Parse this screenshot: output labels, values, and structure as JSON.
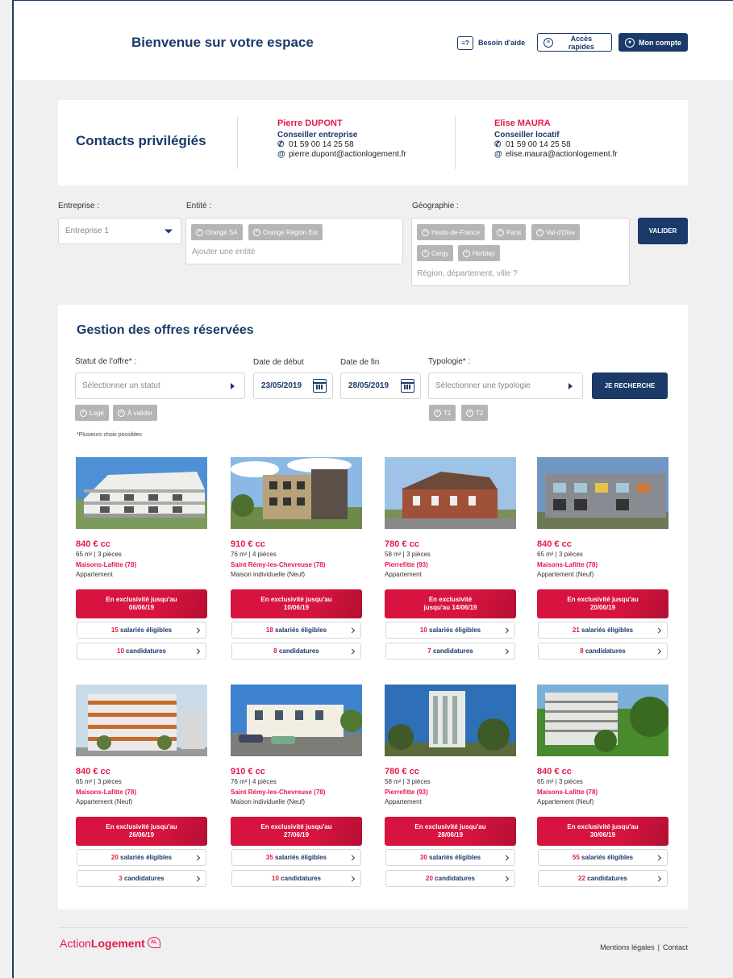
{
  "header": {
    "welcome": "Bienvenue sur votre espace",
    "help": "Besoin d'aide",
    "quick": "Accès rapides",
    "account": "Mon compte"
  },
  "contacts": {
    "title": "Contacts privilégiés",
    "people": [
      {
        "name": "Pierre DUPONT",
        "role": "Conseiller entreprise",
        "phone": "01 59 00 14 25 58",
        "email": "pierre.dupont@actionlogement.fr"
      },
      {
        "name": "Elise MAURA",
        "role": "Conseiller locatif",
        "phone": "01 59 00 14 25 58",
        "email": "elise.maura@actionlogement.fr"
      }
    ]
  },
  "filters": {
    "entreprise_label": "Entreprise :",
    "entreprise_value": "Entreprise 1",
    "entite_label": "Entité :",
    "entite_tags": [
      "Orange SA",
      "Orange Région Est"
    ],
    "entite_placeholder": "Ajouter une entité",
    "geo_label": "Géographie :",
    "geo_tags": [
      "Hauts-de-France",
      "Paris",
      "Val-d'Oise",
      "Cergy",
      "Herblay"
    ],
    "geo_placeholder": "Région, département, ville ?",
    "validate": "VALIDER"
  },
  "offers": {
    "title": "Gestion des offres réservées",
    "status_label": "Statut de l'offre* :",
    "status_placeholder": "Sélectionner un statut",
    "status_tags": [
      "Logé",
      "À valider"
    ],
    "start_label": "Date de début",
    "start_value": "23/05/2019",
    "end_label": "Date de fin",
    "end_value": "28/05/2019",
    "typo_label": "Typologie* :",
    "typo_placeholder": "Sélectionner une typologie",
    "typo_tags": [
      "T1",
      "T2"
    ],
    "search": "JE RECHERCHE",
    "note": "*Plusieurs choix possibles",
    "cards": [
      {
        "price": "840 € cc",
        "spec": "65 m² | 3 pièces",
        "location": "Maisons-Lafitte (78)",
        "type": "Appartement",
        "excl_l1": "En exclusivité jusqu'au",
        "excl_l2": "06/06/19",
        "eligible_n": "15",
        "eligible_t": "salariés éligibles",
        "cand_n": "10",
        "cand_t": "candidatures"
      },
      {
        "price": "910 € cc",
        "spec": "76 m² | 4 pièces",
        "location": "Saint Rémy-les-Chevreuse (78)",
        "type": "Maison individuelle (Neuf)",
        "excl_l1": "En exclusivité jusqu'au",
        "excl_l2": "10/06/19",
        "eligible_n": "18",
        "eligible_t": "salariés éligibles",
        "cand_n": "8",
        "cand_t": "candidatures"
      },
      {
        "price": "780 € cc",
        "spec": "58 m² | 3 pièces",
        "location": "Pierrefitte (93)",
        "type": "Appartement",
        "excl_l1": "En exclusivité",
        "excl_l2": "jusqu'au 14/06/19",
        "eligible_n": "10",
        "eligible_t": "salariés éligibles",
        "cand_n": "7",
        "cand_t": "candidatures"
      },
      {
        "price": "840 € cc",
        "spec": "65 m² | 3 pièces",
        "location": "Maisons-Lafitte (78)",
        "type": "Appartement (Neuf)",
        "excl_l1": "En exclusivité jusqu'au",
        "excl_l2": "20/06/19",
        "eligible_n": "21",
        "eligible_t": "salariés éligibles",
        "cand_n": "8",
        "cand_t": "candidatures"
      },
      {
        "price": "840 € cc",
        "spec": "65 m² | 3 pièces",
        "location": "Maisons-Lafitte (78)",
        "type": "Appartement (Neuf)",
        "excl_l1": "En exclusivité jusqu'au",
        "excl_l2": "26/06/19",
        "eligible_n": "20",
        "eligible_t": "salariés éligibles",
        "cand_n": "3",
        "cand_t": "candidatures"
      },
      {
        "price": "910 € cc",
        "spec": "76 m² | 4 pièces",
        "location": "Saint Rémy-les-Chevreuse (78)",
        "type": "Maison individuelle (Neuf)",
        "excl_l1": "En exclusivité jusqu'au",
        "excl_l2": "27/06/19",
        "eligible_n": "35",
        "eligible_t": "salariés éligibles",
        "cand_n": "10",
        "cand_t": "candidatures"
      },
      {
        "price": "780 € cc",
        "spec": "58 m² | 3 pièces",
        "location": "Pierrefitte (93)",
        "type": "Appartement",
        "excl_l1": "En exclusivité jusqu'au",
        "excl_l2": "28/06/19",
        "eligible_n": "30",
        "eligible_t": "salariés éligibles",
        "cand_n": "20",
        "cand_t": "candidatures"
      },
      {
        "price": "840 € cc",
        "spec": "65 m² | 3 pièces",
        "location": "Maisons-Lafitte (78)",
        "type": "Appartement (Neuf)",
        "excl_l1": "En exclusivité jusqu'au",
        "excl_l2": "30/06/19",
        "eligible_n": "55",
        "eligible_t": "salariés éligibles",
        "cand_n": "22",
        "cand_t": "candidatures"
      }
    ]
  },
  "footer": {
    "logo_a": "Action",
    "logo_b": "Logement",
    "legal": "Mentions légales",
    "sep": "|",
    "contact": "Contact"
  },
  "colors": {
    "navy": "#1b3a6a",
    "brand_red": "#e5194a",
    "tag_grey": "#b5b5b5"
  }
}
